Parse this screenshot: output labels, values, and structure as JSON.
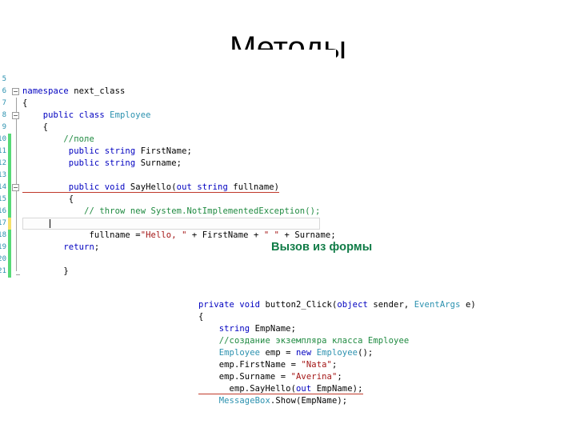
{
  "slide": {
    "title": "Методы",
    "annotation_label": "Вызов из формы",
    "annotation_color": "#0f7b46",
    "background": "#ffffff"
  },
  "theme": {
    "keyword_color": "#0000c0",
    "type_color": "#2b91af",
    "comment_color": "#1f8a40",
    "string_color": "#a31515",
    "plain_color": "#000000",
    "error_underline_color": "#c0392b",
    "gutter_modified_color": "#57d977",
    "gutter_pending_color": "#f5e06a",
    "line_number_color": "#2b91af"
  },
  "code_block_1": {
    "name": "employee-class-editor",
    "lines": [
      {
        "num": "5",
        "change": "none",
        "fold": "none",
        "text": ""
      },
      {
        "num": "6",
        "change": "none",
        "fold": "box",
        "text": "namespace next_class"
      },
      {
        "num": "7",
        "change": "none",
        "fold": "line",
        "text": "{"
      },
      {
        "num": "8",
        "change": "none",
        "fold": "box-line",
        "text": "    public class Employee"
      },
      {
        "num": "9",
        "change": "none",
        "fold": "line",
        "text": "    {"
      },
      {
        "num": "10",
        "change": "modified",
        "fold": "line",
        "text": "        //поле"
      },
      {
        "num": "11",
        "change": "modified",
        "fold": "line",
        "text": "         public string FirstName;"
      },
      {
        "num": "12",
        "change": "modified",
        "fold": "line",
        "text": "         public string Surname;"
      },
      {
        "num": "13",
        "change": "modified",
        "fold": "line",
        "text": ""
      },
      {
        "num": "14",
        "change": "modified",
        "fold": "box-line",
        "text": "         public void SayHello(out string fullname)"
      },
      {
        "num": "15",
        "change": "modified",
        "fold": "line",
        "text": "         {"
      },
      {
        "num": "16",
        "change": "modified",
        "fold": "line",
        "text": "            // throw new System.NotImplementedException();"
      },
      {
        "num": "17",
        "change": "pending",
        "fold": "line",
        "text": ""
      },
      {
        "num": "18",
        "change": "modified",
        "fold": "line",
        "text": "             fullname =\"Hello, \" + FirstName + \" \" + Surname;"
      },
      {
        "num": "19",
        "change": "modified",
        "fold": "line",
        "text": "        return;"
      },
      {
        "num": "20",
        "change": "modified",
        "fold": "line",
        "text": ""
      },
      {
        "num": "21",
        "change": "modified",
        "fold": "end",
        "text": "        }"
      }
    ],
    "error_line_index": 9,
    "current_line_index": 12
  },
  "code_block_2": {
    "name": "button2-click-handler",
    "lines": [
      {
        "text": "private void button2_Click(object sender, EventArgs e)"
      },
      {
        "text": "{"
      },
      {
        "text": "    string EmpName;"
      },
      {
        "text": "    //создание экземпляра класса Employee"
      },
      {
        "text": "    Employee emp = new Employee();"
      },
      {
        "text": "    emp.FirstName = \"Nata\";"
      },
      {
        "text": "    emp.Surname = \"Averina\";"
      },
      {
        "text": "      emp.SayHello(out EmpName);"
      },
      {
        "text": "    MessageBox.Show(EmpName);"
      }
    ],
    "error_line_index": 7
  }
}
